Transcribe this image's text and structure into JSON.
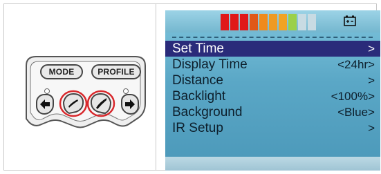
{
  "pad": {
    "mode_label": "MODE",
    "profile_label": "PROFILE",
    "left_arrow_icon": "arrow-left-icon",
    "right_arrow_icon": "arrow-right-icon",
    "highlight_color": "#d8282c"
  },
  "lcd": {
    "battery_segments": [
      "#e01818",
      "#e01818",
      "#e01818",
      "#e05818",
      "#ef8a1c",
      "#ef9a22",
      "#f2a324",
      "#9bd049",
      "#c8dbe3",
      "#c8dbe3"
    ],
    "battery_icon": "battery-icon",
    "menu": [
      {
        "label": "Set Time",
        "value": ">",
        "selected": true
      },
      {
        "label": "Display Time",
        "value": "<24hr>",
        "selected": false
      },
      {
        "label": "Distance",
        "value": ">",
        "selected": false
      },
      {
        "label": "Backlight",
        "value": "<100%>",
        "selected": false
      },
      {
        "label": "Background",
        "value": "<Blue>",
        "selected": false
      },
      {
        "label": "IR Setup",
        "value": ">",
        "selected": false
      }
    ]
  }
}
